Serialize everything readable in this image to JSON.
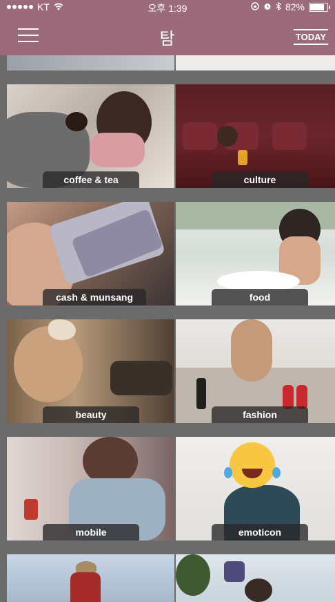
{
  "status_bar": {
    "carrier": "KT",
    "time": "오후 1:39",
    "battery": "82%",
    "battery_level": 0.82
  },
  "nav": {
    "title": "탐",
    "today_label": "TODAY"
  },
  "tiles": [
    {
      "label": "coffee & tea"
    },
    {
      "label": "culture"
    },
    {
      "label": "cash & munsang"
    },
    {
      "label": "food"
    },
    {
      "label": "beauty"
    },
    {
      "label": "fashion"
    },
    {
      "label": "mobile"
    },
    {
      "label": "emoticon"
    }
  ]
}
